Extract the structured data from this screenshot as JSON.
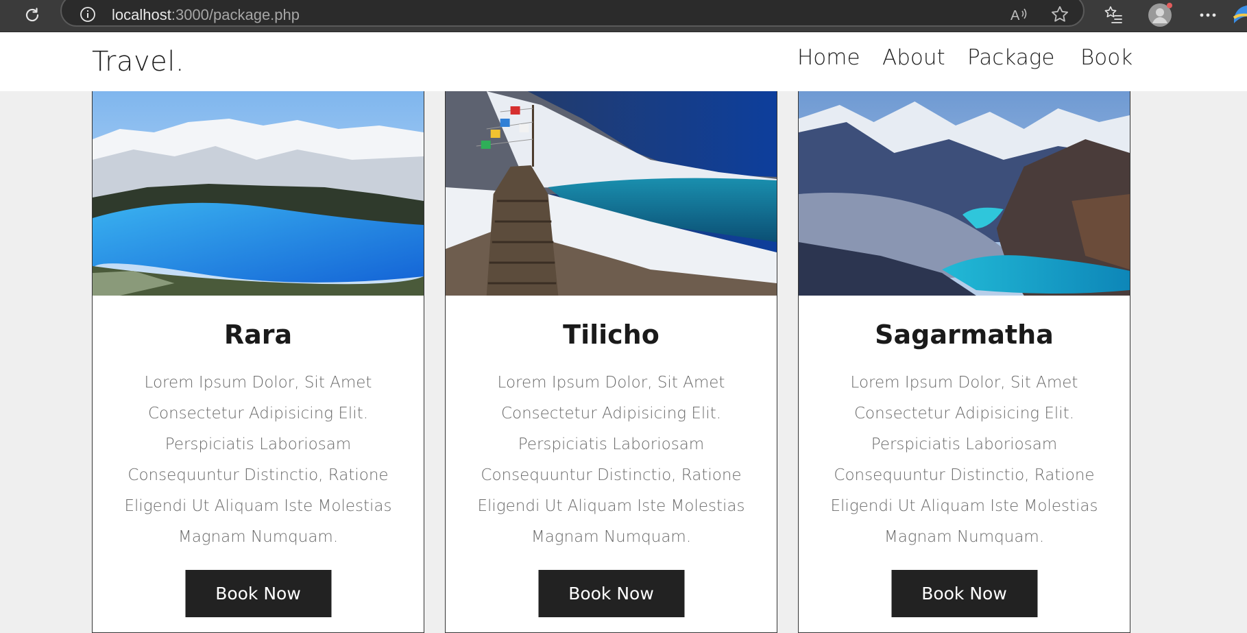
{
  "browser": {
    "url_host": "localhost",
    "url_path": ":3000/package.php"
  },
  "site": {
    "logo": "Travel.",
    "nav": [
      {
        "label": "Home"
      },
      {
        "label": "About"
      },
      {
        "label": "Package"
      },
      {
        "label": "Book"
      }
    ]
  },
  "packages": [
    {
      "title": "Rara",
      "description_lines": [
        "Lorem Ipsum Dolor, Sit Amet",
        "Consectetur Adipisicing Elit.",
        "Perspiciatis Laboriosam",
        "Consequuntur Distinctio, Ratione",
        "Eligendi Ut Aliquam Iste Molestias",
        "Magnam Numquam."
      ],
      "button": "Book Now"
    },
    {
      "title": "Tilicho",
      "description_lines": [
        "Lorem Ipsum Dolor, Sit Amet",
        "Consectetur Adipisicing Elit.",
        "Perspiciatis Laboriosam",
        "Consequuntur Distinctio, Ratione",
        "Eligendi Ut Aliquam Iste Molestias",
        "Magnam Numquam."
      ],
      "button": "Book Now"
    },
    {
      "title": "Sagarmatha",
      "description_lines": [
        "Lorem Ipsum Dolor, Sit Amet",
        "Consectetur Adipisicing Elit.",
        "Perspiciatis Laboriosam",
        "Consequuntur Distinctio, Ratione",
        "Eligendi Ut Aliquam Iste Molestias",
        "Magnam Numquam."
      ],
      "button": "Book Now"
    }
  ],
  "colors": {
    "page_bg": "#efefef",
    "browser_bar": "#3b3b3b",
    "button_bg": "#222222",
    "text_dark": "#1f1f1f",
    "text_muted": "#6a6a6a"
  },
  "icons": {
    "reload": "reload-icon",
    "info": "info-icon",
    "read_aloud": "read-aloud-icon",
    "favorite": "star-icon",
    "favorites_list": "favorites-icon",
    "profile": "profile-icon",
    "more": "more-icon"
  }
}
